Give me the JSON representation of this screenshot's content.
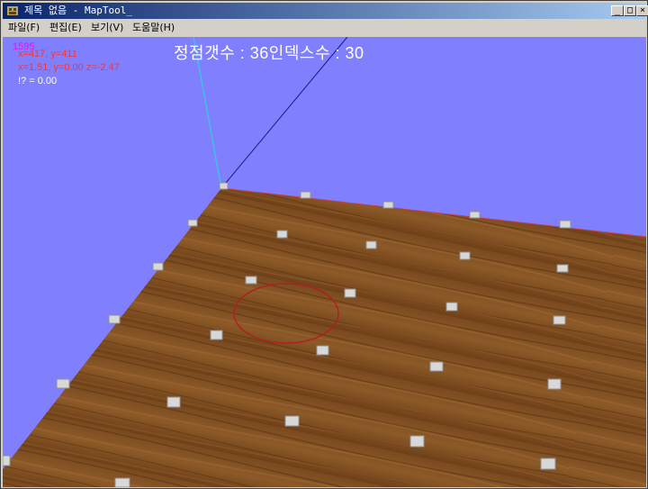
{
  "window": {
    "title": "제목 없음 - MapTool_",
    "controls": {
      "minimize": "_",
      "maximize": "□",
      "close": "×"
    }
  },
  "menu": [
    {
      "label": "파일(F)"
    },
    {
      "label": "편집(E)"
    },
    {
      "label": "보기(V)"
    },
    {
      "label": "도움말(H)"
    }
  ],
  "hud": {
    "fps": "1595",
    "mouse": "x=417, y=411",
    "world": "x=1.51, y=0.00 z=-2.47",
    "extra": "!? = 0.00",
    "summary": "정점갯수 : 36인덱스수 : 30"
  },
  "scene": {
    "background_color": "#8080ff",
    "floor_texture": "wood",
    "vertex_count": 36,
    "index_count": 30,
    "colors": {
      "fps": "#ff00ff",
      "mouse": "#ff3030",
      "world": "#ff3030",
      "extra": "#ffffff",
      "brush_circle": "#b02020",
      "axis_line": "#40c0e0"
    }
  }
}
